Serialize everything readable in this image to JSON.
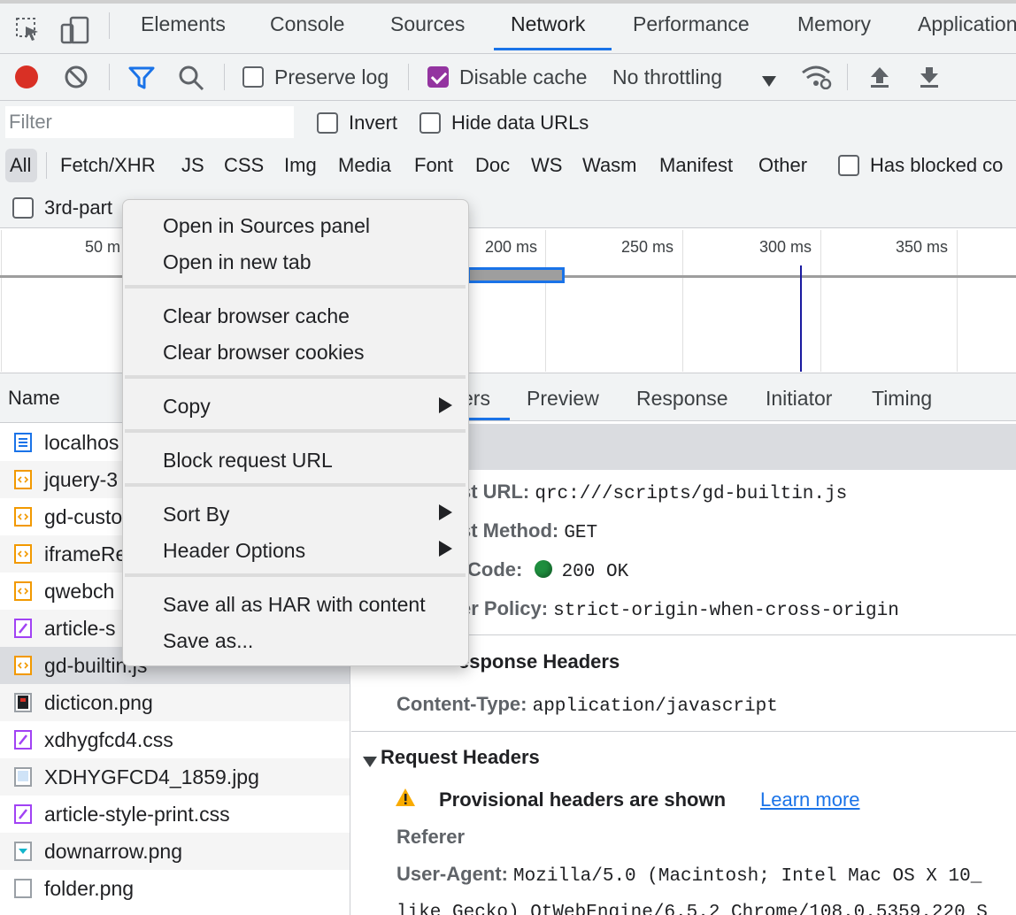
{
  "tabs": [
    "Elements",
    "Console",
    "Sources",
    "Network",
    "Performance",
    "Memory",
    "Application"
  ],
  "active_tab": "Network",
  "toolbar": {
    "preserve_log": "Preserve log",
    "preserve_log_checked": false,
    "disable_cache": "Disable cache",
    "disable_cache_checked": true,
    "throttling": "No throttling",
    "record_color": "#d93025",
    "filter_color": "#1a73e8"
  },
  "filter": {
    "placeholder": "Filter",
    "invert": "Invert",
    "hide_data_urls": "Hide data URLs"
  },
  "types": [
    "All",
    "Fetch/XHR",
    "JS",
    "CSS",
    "Img",
    "Media",
    "Font",
    "Doc",
    "WS",
    "Wasm",
    "Manifest",
    "Other"
  ],
  "has_blocked": "Has blocked co",
  "third_party": "3rd-part",
  "overview": {
    "ticks": [
      "50 m",
      "200 ms",
      "250 ms",
      "300 ms",
      "350 ms"
    ]
  },
  "list": {
    "header": "Name",
    "rows": [
      {
        "name": "localhos",
        "type": "doc"
      },
      {
        "name": "jquery-3",
        "type": "js"
      },
      {
        "name": "gd-custo",
        "type": "js"
      },
      {
        "name": "iframeRe",
        "type": "js"
      },
      {
        "name": "qwebch",
        "type": "js"
      },
      {
        "name": "article-s",
        "type": "css"
      },
      {
        "name": "gd-builtin.js",
        "type": "js"
      },
      {
        "name": "dicticon.png",
        "type": "img-dark"
      },
      {
        "name": "xdhygfcd4.css",
        "type": "css"
      },
      {
        "name": "XDHYGFCD4_1859.jpg",
        "type": "img"
      },
      {
        "name": "article-style-print.css",
        "type": "css"
      },
      {
        "name": "downarrow.png",
        "type": "img-arrow"
      },
      {
        "name": "folder.png",
        "type": "blank"
      }
    ]
  },
  "detail_tabs": [
    "ers",
    "Preview",
    "Response",
    "Initiator",
    "Timing"
  ],
  "general": {
    "request_url_key": "st URL:",
    "request_url": "qrc:///scripts/gd-builtin.js",
    "method_key": "st Method:",
    "method": "GET",
    "status_key": "Code:",
    "status": "200 OK",
    "status_color": "#1e8e3e",
    "policy_key": "er Policy:",
    "policy": "strict-origin-when-cross-origin"
  },
  "response_headers": {
    "title": "esponse Headers",
    "content_type_key": "Content-Type:",
    "content_type": "application/javascript"
  },
  "request_headers": {
    "title": "Request Headers",
    "provisional": "Provisional headers are shown",
    "learn_more": "Learn more",
    "referer": "Referer",
    "ua_key": "User-Agent:",
    "ua_line1": "Mozilla/5.0 (Macintosh; Intel Mac OS X 10_",
    "ua_line2": "like Gecko) QtWebEngine/6.5.2 Chrome/108.0.5359.220 S"
  },
  "context_menu": {
    "open_sources": "Open in Sources panel",
    "open_tab": "Open in new tab",
    "clear_cache": "Clear browser cache",
    "clear_cookies": "Clear browser cookies",
    "copy": "Copy",
    "block_url": "Block request URL",
    "sort_by": "Sort By",
    "header_options": "Header Options",
    "save_har": "Save all as HAR with content",
    "save_as": "Save as..."
  }
}
